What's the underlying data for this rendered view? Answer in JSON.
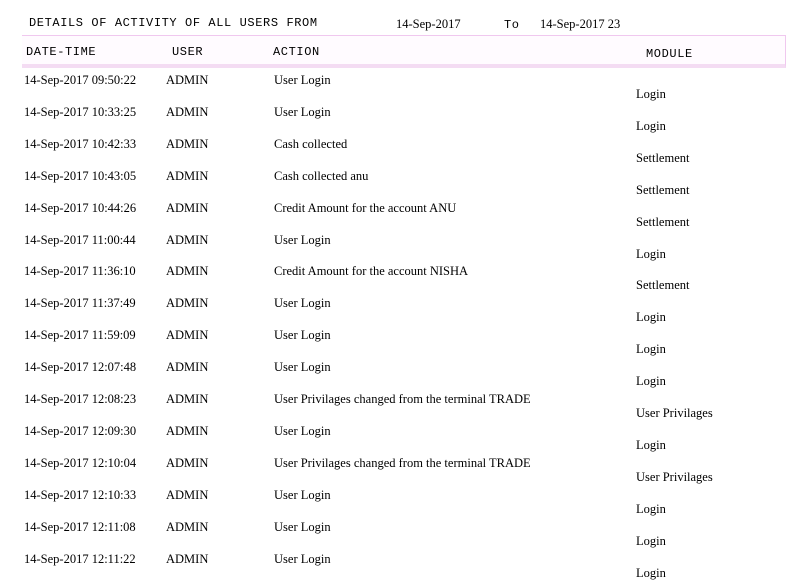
{
  "report": {
    "title": "DETAILS OF ACTIVITY OF ALL USERS FROM",
    "from_date": "14-Sep-2017",
    "to_label": "To",
    "to_date": "14-Sep-2017 23"
  },
  "table": {
    "headers": {
      "datetime": "DATE-TIME",
      "user": "USER",
      "action": "ACTION",
      "module": "MODULE"
    },
    "rows": [
      {
        "datetime": "14-Sep-2017  09:50:22",
        "user": "ADMIN",
        "action": "User Login",
        "module": "Login"
      },
      {
        "datetime": "14-Sep-2017  10:33:25",
        "user": "ADMIN",
        "action": "User Login",
        "module": "Login"
      },
      {
        "datetime": "14-Sep-2017  10:42:33",
        "user": "ADMIN",
        "action": "Cash collected",
        "module": "Settlement"
      },
      {
        "datetime": "14-Sep-2017  10:43:05",
        "user": "ADMIN",
        "action": "Cash collected  anu",
        "module": "Settlement"
      },
      {
        "datetime": "14-Sep-2017  10:44:26",
        "user": "ADMIN",
        "action": "Credit Amount for the account ANU",
        "module": "Settlement"
      },
      {
        "datetime": "14-Sep-2017  11:00:44",
        "user": "ADMIN",
        "action": "User Login",
        "module": "Login"
      },
      {
        "datetime": "14-Sep-2017  11:36:10",
        "user": "ADMIN",
        "action": "Credit Amount for the account NISHA",
        "module": "Settlement"
      },
      {
        "datetime": "14-Sep-2017  11:37:49",
        "user": "ADMIN",
        "action": "User Login",
        "module": "Login"
      },
      {
        "datetime": "14-Sep-2017  11:59:09",
        "user": "ADMIN",
        "action": "User Login",
        "module": "Login"
      },
      {
        "datetime": "14-Sep-2017  12:07:48",
        "user": "ADMIN",
        "action": "User Login",
        "module": "Login"
      },
      {
        "datetime": "14-Sep-2017  12:08:23",
        "user": "ADMIN",
        "action": "User Privilages changed  from the terminal TRADE",
        "module": "User Privilages"
      },
      {
        "datetime": "14-Sep-2017  12:09:30",
        "user": "ADMIN",
        "action": "User Login",
        "module": "Login"
      },
      {
        "datetime": "14-Sep-2017  12:10:04",
        "user": "ADMIN",
        "action": "User Privilages changed  from the terminal TRADE",
        "module": "User Privilages"
      },
      {
        "datetime": "14-Sep-2017  12:10:33",
        "user": "ADMIN",
        "action": "User Login",
        "module": "Login"
      },
      {
        "datetime": "14-Sep-2017  12:11:08",
        "user": "ADMIN",
        "action": "User Login",
        "module": "Login"
      },
      {
        "datetime": "14-Sep-2017  12:11:22",
        "user": "ADMIN",
        "action": "User Login",
        "module": "Login"
      }
    ]
  }
}
